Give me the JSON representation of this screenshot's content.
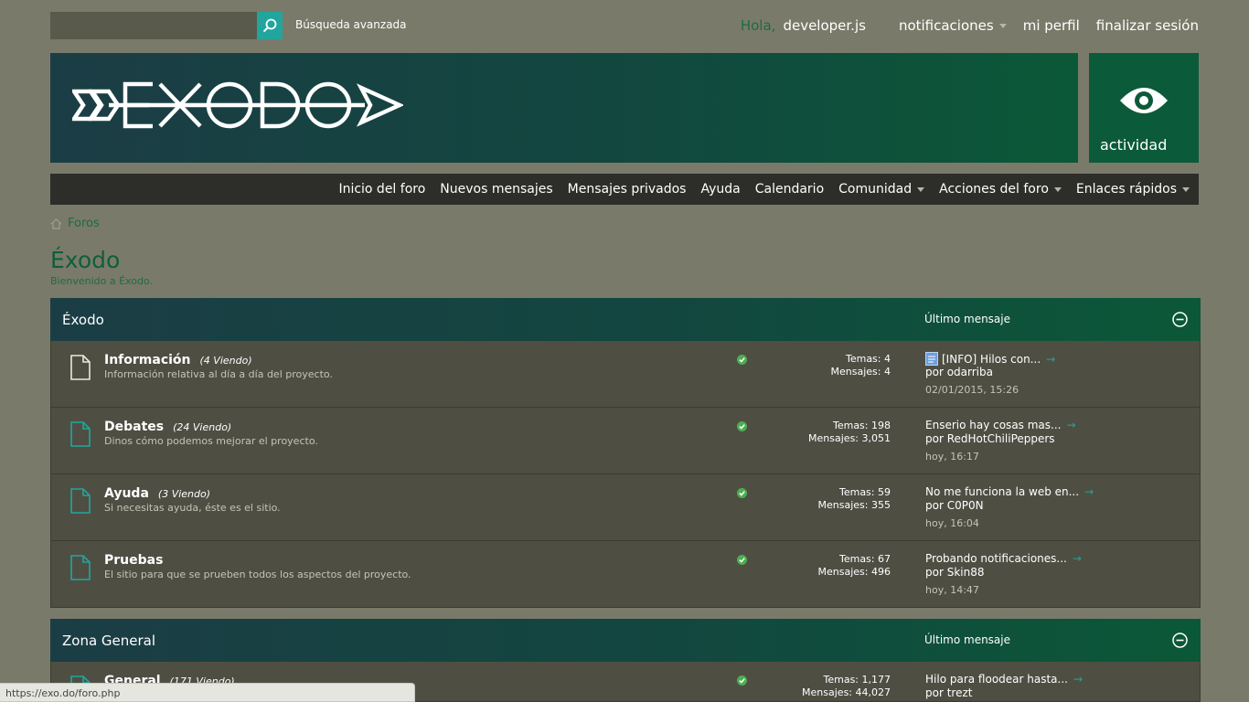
{
  "top": {
    "search_placeholder": "",
    "advanced_search": "Búsqueda avanzada",
    "greeting": "Hola,",
    "username": "developer.js",
    "notifications": "notificaciones",
    "profile": "mi perfil",
    "logout": "finalizar sesión"
  },
  "banner": {
    "logo_text": "EXODO",
    "activity_label": "actividad"
  },
  "nav": {
    "items": [
      "Inicio del foro",
      "Nuevos mensajes",
      "Mensajes privados",
      "Ayuda",
      "Calendario",
      "Comunidad",
      "Acciones del foro",
      "Enlaces rápidos"
    ]
  },
  "breadcrumb": {
    "label": "Foros"
  },
  "page": {
    "title": "Éxodo",
    "subtitle": "Bienvenido a Éxodo."
  },
  "categories": [
    {
      "name": "Éxodo",
      "last_header": "Último mensaje",
      "forums": [
        {
          "title": "Información",
          "viewing": "(4 Viendo)",
          "desc": "Información relativa al día a día del proyecto.",
          "topics": "Temas: 4",
          "posts": "Mensajes: 4",
          "last_title": "[INFO] Hilos con...",
          "last_by": "por odarriba",
          "last_date": "02/01/2015, 15:26"
        },
        {
          "title": "Debates",
          "viewing": "(24 Viendo)",
          "desc": "Dinos cómo podemos mejorar el proyecto.",
          "topics": "Temas: 198",
          "posts": "Mensajes: 3,051",
          "last_title": "Enserio hay cosas mas...",
          "last_by": "por RedHotChiliPeppers",
          "last_date": "hoy, 16:17"
        },
        {
          "title": "Ayuda",
          "viewing": "(3 Viendo)",
          "desc": "Si necesitas ayuda, éste es el sitio.",
          "topics": "Temas: 59",
          "posts": "Mensajes: 355",
          "last_title": "No me funciona la web en...",
          "last_by": "por C0P0N",
          "last_date": "hoy, 16:04"
        },
        {
          "title": "Pruebas",
          "viewing": "",
          "desc": "El sitio para que se prueben todos los aspectos del proyecto.",
          "topics": "Temas: 67",
          "posts": "Mensajes: 496",
          "last_title": "Probando notificaciones...",
          "last_by": "por Skin88",
          "last_date": "hoy, 14:47"
        }
      ]
    },
    {
      "name": "Zona General",
      "last_header": "Último mensaje",
      "forums": [
        {
          "title": "General",
          "viewing": "(171 Viendo)",
          "desc": "",
          "topics": "Temas: 1,177",
          "posts": "Mensajes: 44,027",
          "last_title": "Hilo para floodear hasta...",
          "last_by": "por trezt",
          "last_date": ""
        }
      ]
    }
  ],
  "statusbar": {
    "url": "https://exo.do/foro.php"
  },
  "colors": {
    "accent": "#21a59c",
    "green": "#0f5e3a",
    "bg": "#7a7a6a"
  }
}
